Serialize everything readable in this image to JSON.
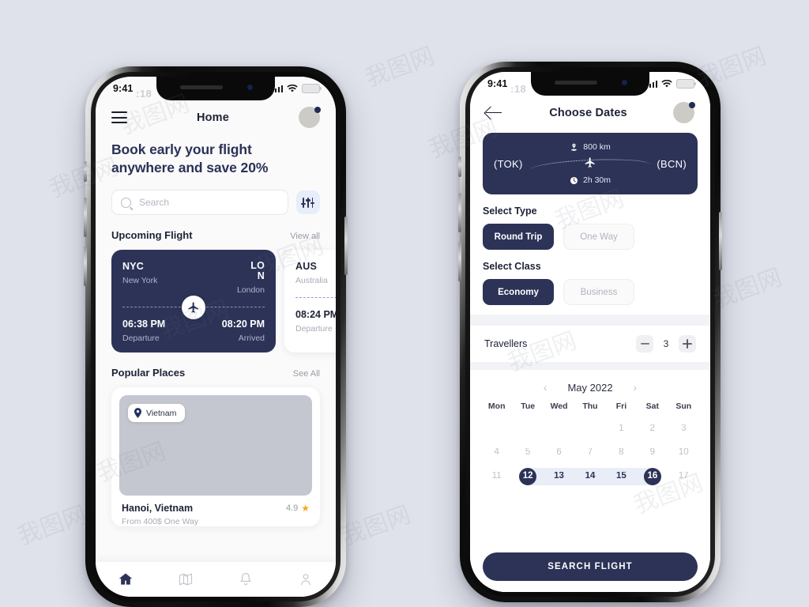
{
  "theme": {
    "navy": "#2c3357",
    "page_bg": "#dfe2ea",
    "accent_light": "#e7edf9",
    "star": "#f0a824"
  },
  "phone1": {
    "status": {
      "time": "9:41",
      "overlay_time": ":18",
      "signal_icon": "cellular-signal-icon",
      "wifi_icon": "wifi-icon",
      "battery_icon": "battery-icon"
    },
    "appbar": {
      "menu_icon": "hamburger-menu-icon",
      "title": "Home",
      "avatar_icon": "user-avatar"
    },
    "hero": {
      "line1": "Book early your flight",
      "line2": "anywhere and save 20%"
    },
    "search": {
      "placeholder": "Search",
      "value": "",
      "icon": "search-icon",
      "filter_icon": "filter-sliders-icon"
    },
    "upcoming": {
      "heading": "Upcoming Flight",
      "link": "View all"
    },
    "flights": [
      {
        "from_code": "NYC",
        "from_city": "New York",
        "to_code": "LON",
        "to_city": "London",
        "depart_time": "06:38 PM",
        "depart_label": "Departure",
        "arrive_time": "08:20 PM",
        "arrive_label": "Arrived",
        "plane_icon": "airplane-icon",
        "style": "dark"
      },
      {
        "from_code": "AUS",
        "from_city": "Australia",
        "depart_time": "08:24 PM",
        "depart_label": "Departure",
        "style": "light"
      }
    ],
    "popular": {
      "heading": "Popular Places",
      "link": "See All"
    },
    "place": {
      "badge": "Vietnam",
      "badge_icon": "location-pin-icon",
      "name": "Hanoi, Vietnam",
      "rating": "4.9",
      "star_icon": "star-icon",
      "price": "From 400$ One Way"
    },
    "tabs": [
      {
        "name": "home",
        "icon": "home-icon",
        "active": true
      },
      {
        "name": "map",
        "icon": "map-icon",
        "active": false
      },
      {
        "name": "notifications",
        "icon": "bell-icon",
        "active": false
      },
      {
        "name": "profile",
        "icon": "person-icon",
        "active": false
      }
    ]
  },
  "phone2": {
    "status": {
      "time": "9:41",
      "overlay_time": ":18"
    },
    "appbar": {
      "back_icon": "back-arrow-icon",
      "title": "Choose Dates",
      "avatar_icon": "user-avatar"
    },
    "banner": {
      "distance": "800 km",
      "distance_icon": "distance-marker-icon",
      "duration": "2h 30m",
      "duration_icon": "clock-icon",
      "from_code": "(TOK)",
      "to_code": "(BCN)",
      "plane_icon": "airplane-icon"
    },
    "select_type": {
      "heading": "Select Type",
      "options": [
        {
          "label": "Round Trip",
          "selected": true
        },
        {
          "label": "One Way",
          "selected": false
        }
      ]
    },
    "select_class": {
      "heading": "Select Class",
      "options": [
        {
          "label": "Economy",
          "selected": true
        },
        {
          "label": "Business",
          "selected": false
        }
      ]
    },
    "travellers": {
      "label": "Travellers",
      "count": "3",
      "minus": "—",
      "plus": "+"
    },
    "calendar": {
      "month": "May 2022",
      "prev_icon": "chevron-left-icon",
      "next_icon": "chevron-right-icon",
      "dow": [
        "Mon",
        "Tue",
        "Wed",
        "Thu",
        "Fri",
        "Sat",
        "Sun"
      ],
      "weeks": [
        [
          {
            "d": ""
          },
          {
            "d": ""
          },
          {
            "d": ""
          },
          {
            "d": ""
          },
          {
            "d": "1"
          },
          {
            "d": "2"
          },
          {
            "d": "3"
          }
        ],
        [
          {
            "d": "4"
          },
          {
            "d": "5"
          },
          {
            "d": "6"
          },
          {
            "d": "7"
          },
          {
            "d": "8"
          },
          {
            "d": "9"
          },
          {
            "d": "10"
          }
        ],
        [
          {
            "d": "11"
          },
          {
            "d": "12",
            "state": "start"
          },
          {
            "d": "13",
            "state": "range"
          },
          {
            "d": "14",
            "state": "range"
          },
          {
            "d": "15",
            "state": "range"
          },
          {
            "d": "16",
            "state": "end"
          },
          {
            "d": "17"
          }
        ]
      ],
      "range_start": "12",
      "range_end": "16"
    },
    "cta": {
      "label": "SEARCH FLIGHT"
    }
  },
  "watermark": {
    "text": "我图网"
  }
}
